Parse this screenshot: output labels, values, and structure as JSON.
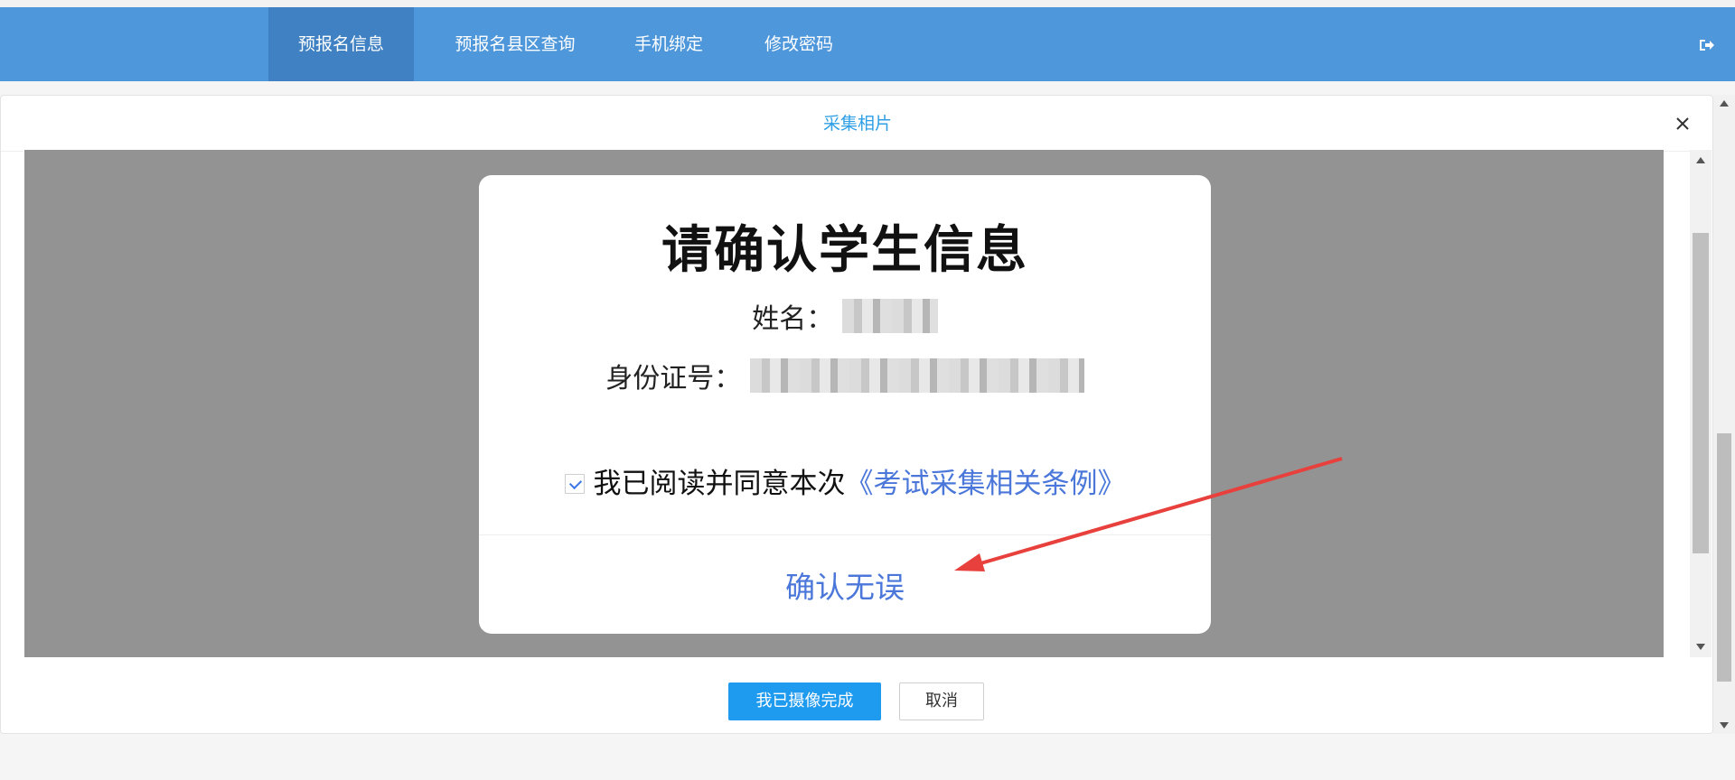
{
  "nav": {
    "items": [
      {
        "label": "预报名信息",
        "active": true
      },
      {
        "label": "预报名县区查询",
        "active": false
      },
      {
        "label": "手机绑定",
        "active": false
      },
      {
        "label": "修改密码",
        "active": false
      }
    ],
    "logout_icon": "sign-out-icon"
  },
  "dialog": {
    "title": "采集相片",
    "close_icon": "close-icon"
  },
  "modal": {
    "title": "请确认学生信息",
    "name_label": "姓名：",
    "id_label": "身份证号：",
    "agree_checked": true,
    "agree_text": "我已阅读并同意本次",
    "agree_link": "《考试采集相关条例》",
    "confirm_label": "确认无误"
  },
  "actions": {
    "done_label": "我已摄像完成",
    "cancel_label": "取消"
  },
  "colors": {
    "navbar": "#4f97db",
    "nav_active": "#3f81c2",
    "primary": "#1e9aef",
    "link": "#4a77d9",
    "annotation_arrow": "#e8403c"
  }
}
